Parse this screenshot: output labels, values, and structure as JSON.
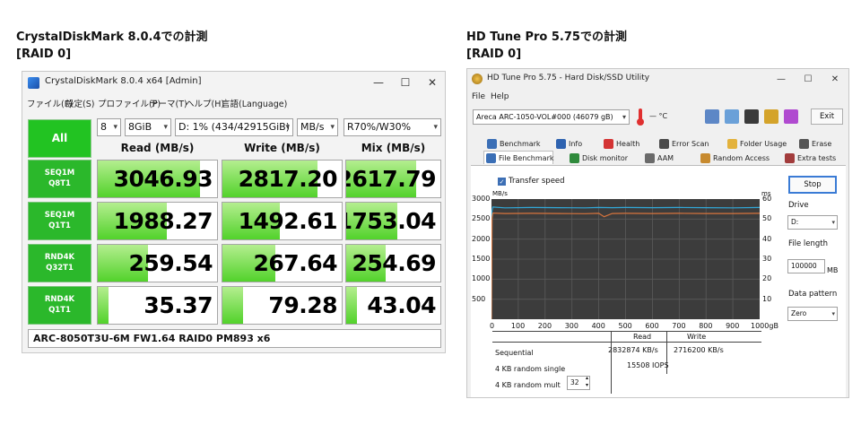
{
  "headings": {
    "left": {
      "line1": "CrystalDiskMark 8.0.4での計測",
      "line2": "[RAID 0]"
    },
    "right": {
      "line1": "HD Tune Pro 5.75での計測",
      "line2": "[RAID 0]"
    }
  },
  "cdm": {
    "window_title": "CrystalDiskMark 8.0.4 x64 [Admin]",
    "controls": {
      "minimize": "—",
      "maximize": "☐",
      "close": "✕"
    },
    "menu": [
      "ファイル(F)",
      "設定(S)",
      "プロファイル(P)",
      "テーマ(T)",
      "ヘルプ(H)",
      "言語(Language)"
    ],
    "all_label": "All",
    "count": "8",
    "size": "8GiB",
    "drive": "D: 1% (434/42915GiB)",
    "unit": "MB/s",
    "mix": "R70%/W30%",
    "columns": [
      "Read (MB/s)",
      "Write (MB/s)",
      "Mix (MB/s)"
    ],
    "rows": [
      {
        "line1": "SEQ1M",
        "line2": "Q8T1",
        "read": "3046.93",
        "write": "2817.20",
        "mix": "2617.79",
        "fill": [
          0.86,
          0.8,
          0.74
        ]
      },
      {
        "line1": "SEQ1M",
        "line2": "Q1T1",
        "read": "1988.27",
        "write": "1492.61",
        "mix": "1753.04",
        "fill": [
          0.58,
          0.48,
          0.54
        ]
      },
      {
        "line1": "RND4K",
        "line2": "Q32T1",
        "read": "259.54",
        "write": "267.64",
        "mix": "254.69",
        "fill": [
          0.42,
          0.44,
          0.42
        ]
      },
      {
        "line1": "RND4K",
        "line2": "Q1T1",
        "read": "35.37",
        "write": "79.28",
        "mix": "43.04",
        "fill": [
          0.09,
          0.17,
          0.11
        ]
      }
    ],
    "status": "ARC-8050T3U-6M FW1.64 RAID0 PM893 x6"
  },
  "hdtune": {
    "window_title": "HD Tune Pro 5.75 - Hard Disk/SSD Utility",
    "controls": {
      "minimize": "—",
      "maximize": "☐",
      "close": "✕"
    },
    "menu": [
      "File",
      "Help"
    ],
    "drive": "Areca  ARC-1050-VOL#000 (46079 gB)",
    "temp": "— °C",
    "exit_label": "Exit",
    "tabs_row1": [
      "Benchmark",
      "Info",
      "Health",
      "Error Scan",
      "Folder Usage",
      "Erase"
    ],
    "tabs_row2": [
      "File Benchmark",
      "Disk monitor",
      "AAM",
      "Random Access",
      "Extra tests"
    ],
    "transfer_speed_label": "Transfer speed",
    "y_unit_left": "MB/s",
    "y_unit_right": "ms",
    "y_left": [
      "3000",
      "2500",
      "2000",
      "1500",
      "1000",
      "500"
    ],
    "y_right": [
      "60",
      "50",
      "40",
      "30",
      "20",
      "10"
    ],
    "x_ticks": [
      "0",
      "100",
      "200",
      "300",
      "400",
      "500",
      "600",
      "700",
      "800",
      "900",
      "1000gB"
    ],
    "results": {
      "col_read": "Read",
      "col_write": "Write",
      "sequential_label": "Sequential",
      "sequential_read": "2832874 KB/s",
      "sequential_write": "2716200 KB/s",
      "single_label": "4 KB random single",
      "single_read": "15508 IOPS",
      "multi_label": "4 KB random mult",
      "multi_value": "32"
    },
    "stop_label": "Stop",
    "drive_label": "Drive",
    "drive_value": "D:",
    "filesize_label": "File length",
    "filesize_value": "100000",
    "filesize_unit": "MB",
    "pattern_label": "Data pattern",
    "pattern_value": "Zero",
    "chart_data": {
      "type": "line",
      "x_range": [
        0,
        1000
      ],
      "y_range": [
        0,
        3000
      ],
      "series": [
        {
          "color": "#31a8d8",
          "x": [
            0,
            2,
            5,
            50,
            150,
            250,
            350,
            400,
            450,
            500,
            600,
            700,
            800,
            900,
            1000
          ],
          "y": [
            0,
            2700,
            2800,
            2780,
            2790,
            2785,
            2780,
            2790,
            2785,
            2790,
            2785,
            2790,
            2785,
            2780,
            2790
          ]
        },
        {
          "color": "#d8743c",
          "x": [
            0,
            2,
            5,
            50,
            150,
            250,
            350,
            400,
            420,
            450,
            500,
            600,
            700,
            800,
            900,
            1000
          ],
          "y": [
            0,
            2500,
            2650,
            2640,
            2645,
            2640,
            2635,
            2645,
            2560,
            2640,
            2645,
            2640,
            2645,
            2640,
            2640,
            2645
          ]
        }
      ]
    }
  }
}
